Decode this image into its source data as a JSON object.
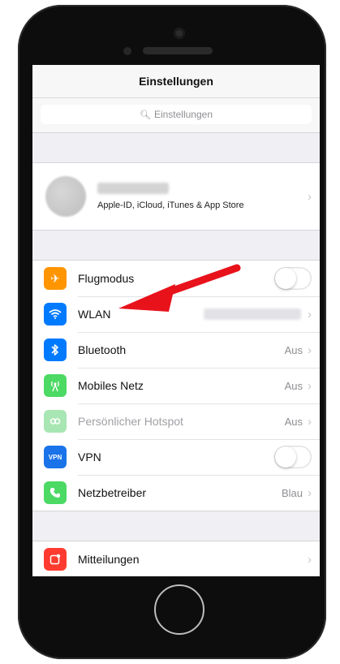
{
  "nav": {
    "title": "Einstellungen"
  },
  "search": {
    "placeholder": "Einstellungen"
  },
  "profile": {
    "subtitle": "Apple-ID, iCloud, iTunes & App Store"
  },
  "settings": [
    {
      "id": "flugmodus",
      "label": "Flugmodus",
      "icon": "airplane-icon",
      "color": "#ff9500",
      "control": "toggle",
      "toggle_on": false
    },
    {
      "id": "wlan",
      "label": "WLAN",
      "icon": "wifi-icon",
      "color": "#007aff",
      "control": "chevron",
      "value": ""
    },
    {
      "id": "bluetooth",
      "label": "Bluetooth",
      "icon": "bluetooth-icon",
      "color": "#007aff",
      "control": "chevron",
      "value": "Aus"
    },
    {
      "id": "mobiles-netz",
      "label": "Mobiles Netz",
      "icon": "antenna-icon",
      "color": "#4cd964",
      "control": "chevron",
      "value": "Aus"
    },
    {
      "id": "hotspot",
      "label": "Persönlicher Hotspot",
      "icon": "hotspot-icon",
      "color": "#a8e6b4",
      "control": "chevron",
      "value": "Aus",
      "disabled": true
    },
    {
      "id": "vpn",
      "label": "VPN",
      "icon_text": "VPN",
      "icon": "vpn-icon",
      "color": "#1a73e8",
      "control": "toggle",
      "toggle_on": false
    },
    {
      "id": "netzbetreiber",
      "label": "Netzbetreiber",
      "icon": "phone-icon",
      "color": "#4cd964",
      "control": "chevron",
      "value": "Blau"
    }
  ],
  "settings2": [
    {
      "id": "mitteilungen",
      "label": "Mitteilungen",
      "icon": "notifications-icon",
      "color": "#ff3b30"
    }
  ],
  "colors": {
    "arrow": "#e8121b",
    "background": "#efeff4"
  }
}
